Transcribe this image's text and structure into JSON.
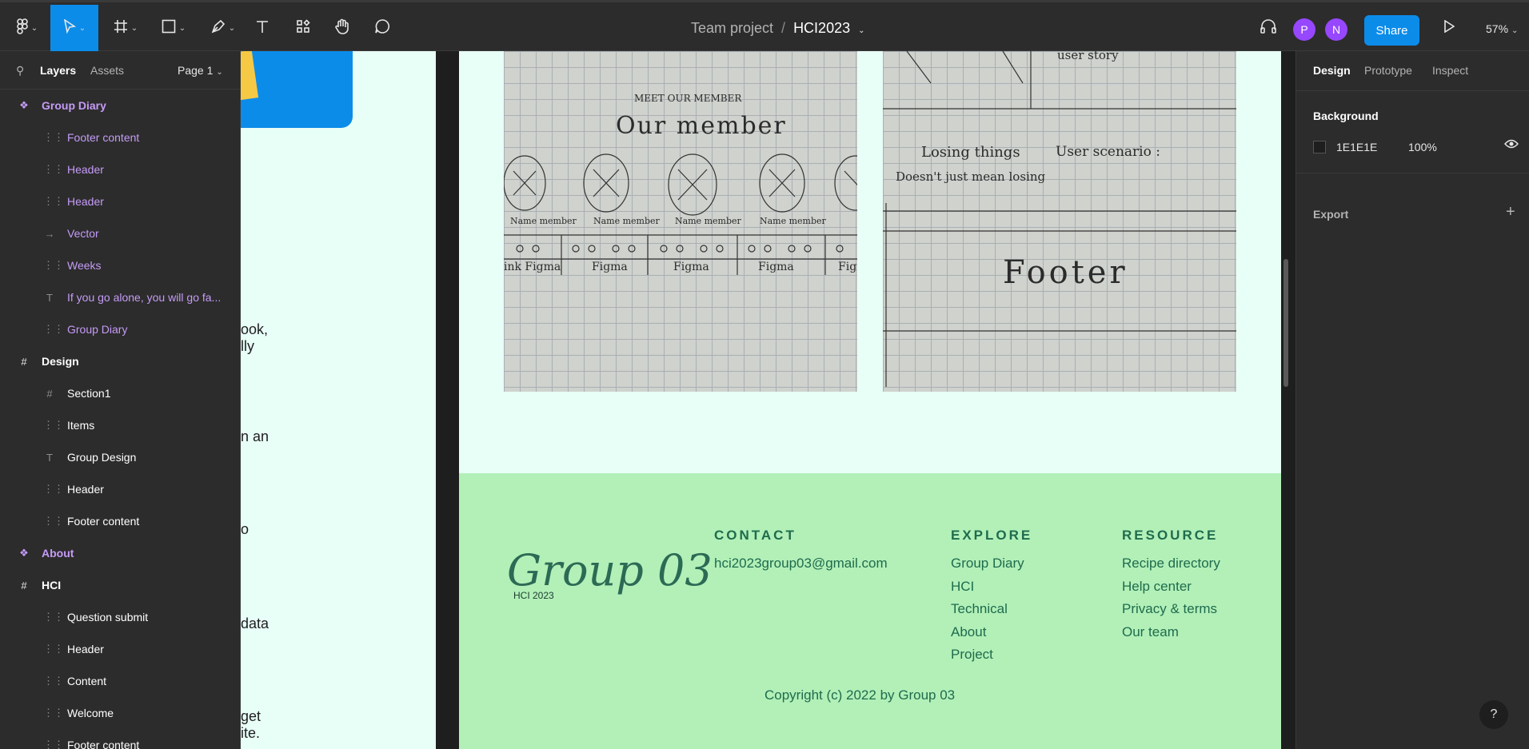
{
  "toolbar": {
    "project": "Team project",
    "separator": "/",
    "file": "HCI2023",
    "share": "Share",
    "zoom": "57%",
    "avatars": [
      "P",
      "N"
    ]
  },
  "left_panel": {
    "tabs": {
      "layers": "Layers",
      "assets": "Assets",
      "page": "Page 1"
    },
    "layers": [
      {
        "label": "Group Diary",
        "icon": "component-icon"
      },
      {
        "label": "Footer content",
        "icon": "frame-icon"
      },
      {
        "label": "Header",
        "icon": "frame-icon"
      },
      {
        "label": "Header",
        "icon": "frame-icon"
      },
      {
        "label": "Vector",
        "icon": "arrow-icon"
      },
      {
        "label": "Weeks",
        "icon": "frame-icon"
      },
      {
        "label": "If you go alone, you will go fa...",
        "icon": "text-icon"
      },
      {
        "label": "Group Diary",
        "icon": "frame-icon"
      },
      {
        "label": "Design",
        "icon": "hash-icon"
      },
      {
        "label": "Section1",
        "icon": "hash-icon"
      },
      {
        "label": "Items",
        "icon": "frame-icon"
      },
      {
        "label": "Group Design",
        "icon": "text-icon"
      },
      {
        "label": "Header",
        "icon": "frame-icon"
      },
      {
        "label": "Footer content",
        "icon": "frame-icon"
      },
      {
        "label": "About",
        "icon": "component-icon"
      },
      {
        "label": "HCI",
        "icon": "hash-icon"
      },
      {
        "label": "Question submit",
        "icon": "frame-icon"
      },
      {
        "label": "Header",
        "icon": "frame-icon"
      },
      {
        "label": "Content",
        "icon": "frame-icon"
      },
      {
        "label": "Welcome",
        "icon": "frame-icon"
      },
      {
        "label": "Footer content",
        "icon": "frame-icon"
      }
    ]
  },
  "canvas": {
    "left_fragments": [
      "ook,",
      "lly",
      "n an",
      "o",
      "data",
      "get",
      "ite."
    ],
    "sketch1": {
      "title_small": "MEET OUR MEMBER",
      "title": "Our member",
      "name_label": "Name member",
      "link_label": "Figma",
      "link_first": "ink Figma"
    },
    "sketch2": {
      "top_text": "user story",
      "losing": "Losing things",
      "scenario": "User scenario :",
      "doesnt": "Doesn't just mean losing",
      "footer": "Footer"
    },
    "footer": {
      "logo": "Group 03",
      "logo_sub": "HCI 2023",
      "contact_head": "CONTACT",
      "contact_email": "hci2023group03@gmail.com",
      "explore_head": "EXPLORE",
      "explore_links": [
        "Group Diary",
        "HCI",
        "Technical",
        "About",
        "Project"
      ],
      "resource_head": "RESOURCE",
      "resource_links": [
        "Recipe directory",
        "Help center",
        "Privacy & terms",
        "Our team"
      ],
      "copyright": "Copyright (c) 2022 by Group 03"
    }
  },
  "right_panel": {
    "tabs": [
      "Design",
      "Prototype",
      "Inspect"
    ],
    "background_label": "Background",
    "background_hex": "1E1E1E",
    "background_opacity": "100%",
    "export_label": "Export"
  },
  "help": "?"
}
